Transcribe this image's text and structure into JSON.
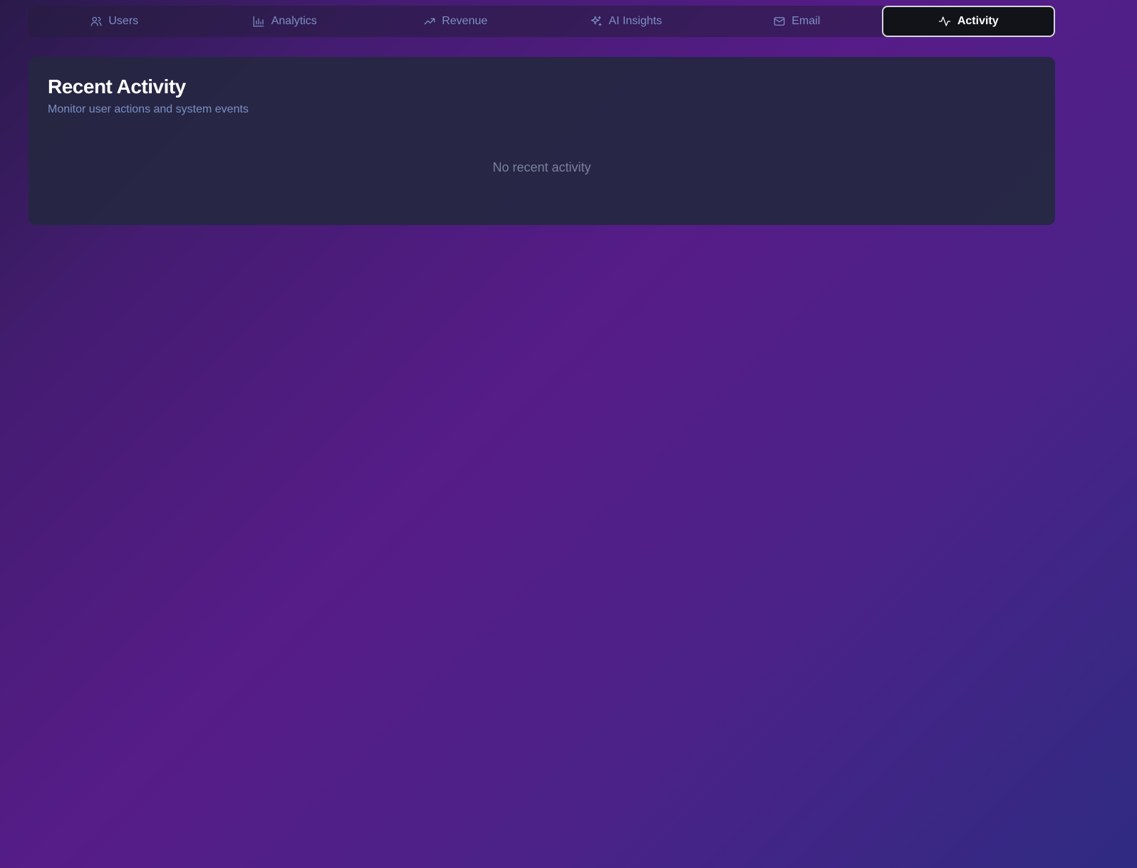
{
  "tabs": [
    {
      "label": "Users",
      "icon": "users-icon"
    },
    {
      "label": "Analytics",
      "icon": "bar-chart-icon"
    },
    {
      "label": "Revenue",
      "icon": "trending-up-icon"
    },
    {
      "label": "AI Insights",
      "icon": "sparkles-icon"
    },
    {
      "label": "Email",
      "icon": "mail-icon"
    },
    {
      "label": "Activity",
      "icon": "activity-icon",
      "active": true
    }
  ],
  "activity": {
    "title": "Recent Activity",
    "subtitle": "Monitor user actions and system events",
    "empty_message": "No recent activity"
  },
  "colors": {
    "accent_text": "#7c8fc4",
    "active_tab_bg": "#121318",
    "card_bg": "#252742"
  }
}
